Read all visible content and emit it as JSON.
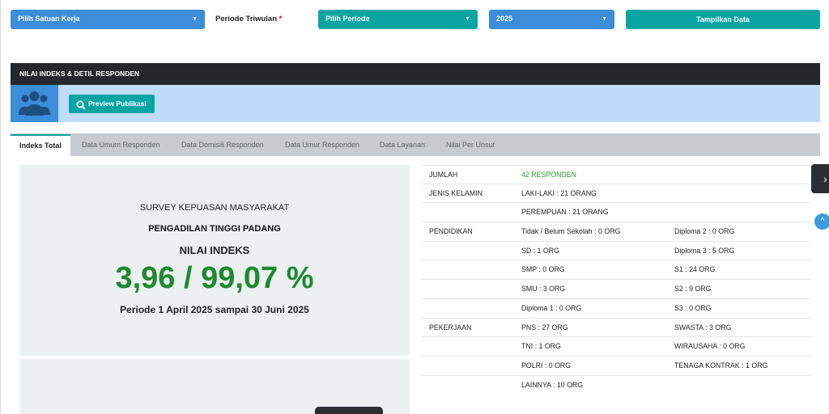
{
  "filters": {
    "satuan_kerja": "Pilih Satuan Kerja",
    "periode_label": "Periode Triwulan",
    "periode_required": "*",
    "periode_select": "Pilih Periode",
    "tahun": "2025",
    "tampilkan": "Tampilkan Data",
    "arrow": "▼"
  },
  "panel": {
    "title": "NILAI INDEKS & DETIL RESPONDEN",
    "preview_button": "Preview Publikasi"
  },
  "tabs": [
    {
      "label": "Indeks Total"
    },
    {
      "label": "Data Umum Responden"
    },
    {
      "label": "Data Domisili Responden"
    },
    {
      "label": "Data Umur Responden"
    },
    {
      "label": "Data Layanan"
    },
    {
      "label": "Nilai Per Unsur"
    }
  ],
  "summary": {
    "line1": "SURVEY KEPUASAN MASYARAKAT",
    "line2": "PENGADILAN TINGGI PADANG",
    "line3": "NILAI INDEKS",
    "index": "3,96 / 99,07 %",
    "period": "Periode 1 April 2025 sampai 30 Juni 2025"
  },
  "detail": {
    "rows": [
      {
        "c1": "JUMLAH",
        "c2": "42 RESPONDEN",
        "c3": ""
      },
      {
        "c1": "JENIS KELAMIN",
        "c2": "LAKI-LAKI : 21 ORANG",
        "c3": ""
      },
      {
        "c1": "",
        "c2": "PEREMPUAN : 21 ORANG",
        "c3": ""
      },
      {
        "c1": "PENDIDIKAN",
        "c2": "Tidak / Belum Sekolah : 0 ORG",
        "c3": "Diploma 2 : 0 ORG"
      },
      {
        "c1": "",
        "c2": "SD : 1 ORG",
        "c3": "Diploma 3 : 5 ORG"
      },
      {
        "c1": "",
        "c2": "SMP : 0 ORG",
        "c3": "S1 : 24 ORG"
      },
      {
        "c1": "",
        "c2": "SMU : 3 ORG",
        "c3": "S2 : 9 ORG"
      },
      {
        "c1": "",
        "c2": "Diploma 1 : 0 ORG",
        "c3": "S3 : 0 ORG"
      },
      {
        "c1": "PEKERJAAN",
        "c2": "PNS : 27 ORG",
        "c3": "SWASTA : 3 ORG"
      },
      {
        "c1": "",
        "c2": "TNI : 1 ORG",
        "c3": "WIRAUSAHA : 0 ORG"
      },
      {
        "c1": "",
        "c2": "POLRI : 0 ORG",
        "c3": "TENAGA KONTRAK : 1 ORG"
      },
      {
        "c1": "",
        "c2": "LAINNYA : 10 ORG",
        "c3": ""
      }
    ]
  },
  "widgets": {
    "edge_tab": "›",
    "edge_up": "^"
  },
  "colors": {
    "blue": "#3c8dda",
    "teal": "#0aa5a3",
    "dark": "#24282c",
    "green_index": "#1e8a2e"
  }
}
